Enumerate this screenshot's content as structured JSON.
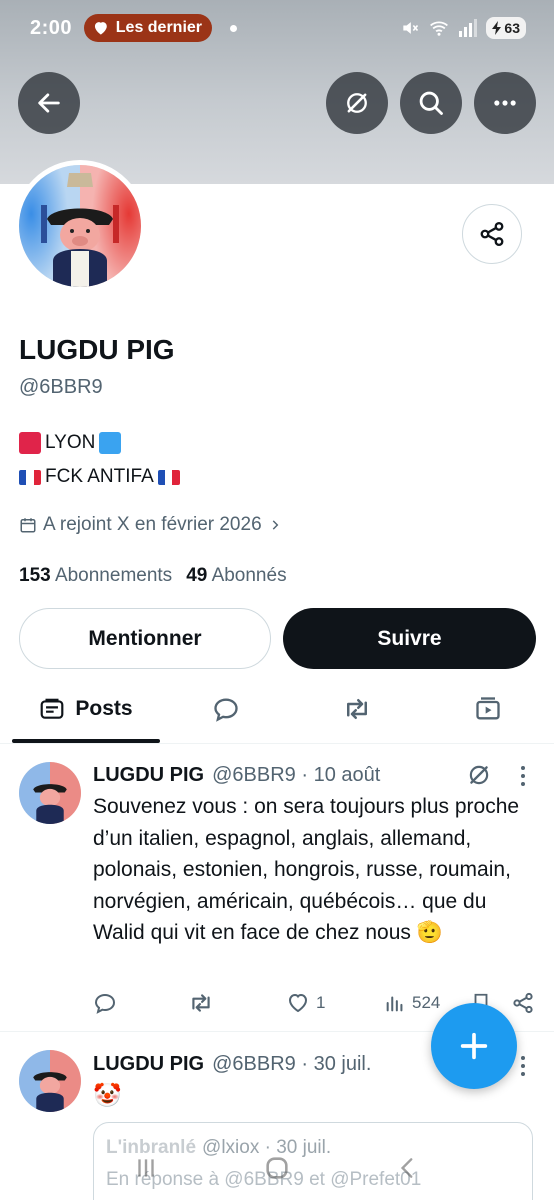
{
  "status_bar": {
    "time": "2:00",
    "notification": "Les dernier",
    "battery": "63"
  },
  "header": {
    "back_icon": "arrow-left-icon",
    "grok_icon": "grok-icon",
    "search_icon": "search-icon",
    "more_icon": "more-icon"
  },
  "profile": {
    "name": "LUGDU PIG",
    "handle": "@6BBR9",
    "bio_line1": "LYON",
    "bio_line2": "FCK ANTIFA",
    "joined": "A rejoint X en février 2026",
    "following_count": "153",
    "following_label": "Abonnements",
    "followers_count": "49",
    "followers_label": "Abonnés"
  },
  "buttons": {
    "mention": "Mentionner",
    "follow": "Suivre"
  },
  "tabs": {
    "posts": "Posts"
  },
  "posts": [
    {
      "name": "LUGDU PIG",
      "meta": "@6BBR9 · 10 août",
      "body": "Souvenez vous : on sera toujours plus proche d’un italien, espagnol, anglais, allemand, polonais, estonien, hongrois, russe, roumain, norvégien, américain, québécois… que du Walid qui vit en face de chez nous 🫡",
      "likes": "1",
      "views": "524"
    },
    {
      "name": "LUGDU PIG",
      "meta": "@6BBR9 · 30 juil.",
      "body": "🤡",
      "quote": {
        "name": "L'inbranlé",
        "meta": "@lxiox · 30 juil.",
        "reply": "En réponse à @6BBR9 et @Prefet01"
      }
    }
  ],
  "colors": {
    "accent": "#1d9bf0",
    "text": "#0f1419",
    "secondary": "#536471",
    "follow_bg": "#0f1419"
  }
}
